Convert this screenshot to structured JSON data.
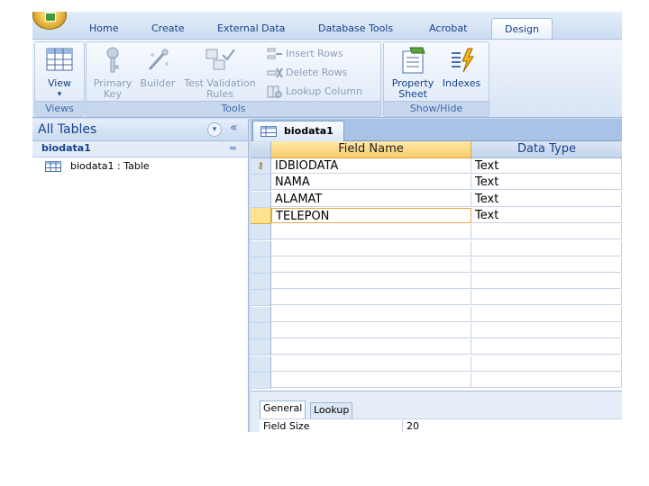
{
  "ribbon": {
    "tabs": [
      "Home",
      "Create",
      "External Data",
      "Database Tools",
      "Acrobat",
      "Design"
    ],
    "active_tab": "Design",
    "groups": {
      "views": {
        "title": "Views",
        "view_line1": "View",
        "view_arrow": "▾"
      },
      "tools": {
        "title": "Tools",
        "primary_key_line1": "Primary",
        "primary_key_line2": "Key",
        "builder": "Builder",
        "test_line1": "Test Validation",
        "test_line2": "Rules",
        "insert_rows": "Insert Rows",
        "delete_rows": "Delete Rows",
        "lookup_column": "Lookup Column"
      },
      "show_hide": {
        "title": "Show/Hide",
        "property_line1": "Property",
        "property_line2": "Sheet",
        "indexes": "Indexes"
      }
    }
  },
  "nav": {
    "title": "All Tables",
    "dropdown_glyph": "▾",
    "collapse_glyph": "«",
    "group_label": "biodata1",
    "group_chevron": "≈",
    "item_label": "biodata1 : Table"
  },
  "document": {
    "tab_label": "biodata1",
    "columns": [
      "Field Name",
      "Data Type"
    ],
    "rows": [
      {
        "field": "IDBIODATA",
        "type": "Text",
        "primary_key": true
      },
      {
        "field": "NAMA",
        "type": "Text",
        "primary_key": false
      },
      {
        "field": "ALAMAT",
        "type": "Text",
        "primary_key": false
      },
      {
        "field": "TELEPON",
        "type": "Text",
        "primary_key": false
      }
    ],
    "primary_key_glyph": "⚷",
    "empty_rows": 10
  },
  "properties": {
    "tabs": [
      "General",
      "Lookup"
    ],
    "active_tab": "General",
    "field_size_label": "Field Size",
    "field_size_value": "20"
  },
  "colors": {
    "accent": "#15428b",
    "header_highlight": "#f8cd6b",
    "ribbon_bg": "#dde8f6"
  }
}
